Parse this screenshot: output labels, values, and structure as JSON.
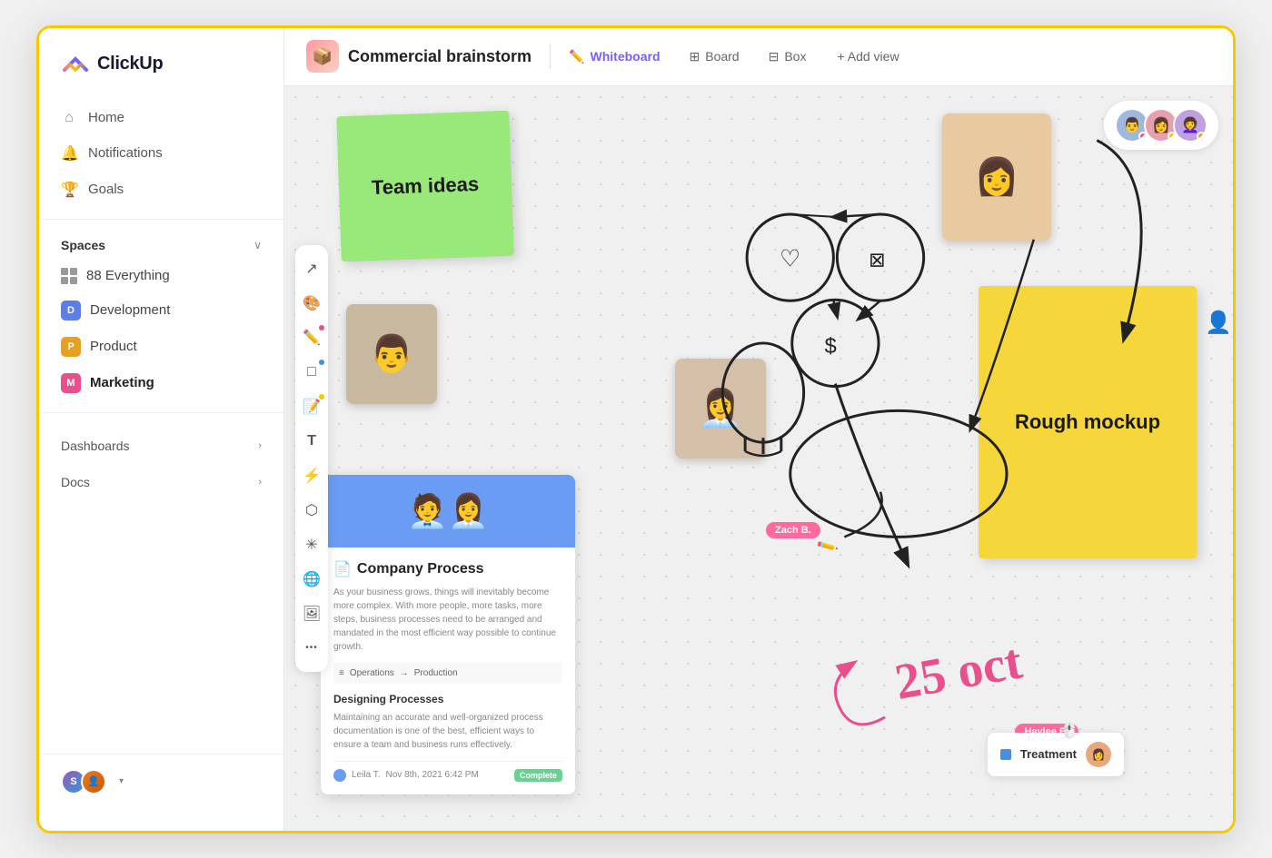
{
  "app": {
    "name": "ClickUp"
  },
  "sidebar": {
    "nav": [
      {
        "id": "home",
        "label": "Home",
        "icon": "⌂"
      },
      {
        "id": "notifications",
        "label": "Notifications",
        "icon": "🔔"
      },
      {
        "id": "goals",
        "label": "Goals",
        "icon": "🏆"
      }
    ],
    "spaces_label": "Spaces",
    "spaces": [
      {
        "id": "everything",
        "label": "Everything",
        "count": "88"
      },
      {
        "id": "development",
        "label": "Development",
        "badge": "D",
        "color": "#5b7fe8"
      },
      {
        "id": "product",
        "label": "Product",
        "badge": "P",
        "color": "#e8a020"
      },
      {
        "id": "marketing",
        "label": "Marketing",
        "badge": "M",
        "color": "#e84f8c",
        "bold": true
      }
    ],
    "sections": [
      {
        "id": "dashboards",
        "label": "Dashboards"
      },
      {
        "id": "docs",
        "label": "Docs"
      }
    ]
  },
  "header": {
    "page_icon": "📦",
    "page_title": "Commercial brainstorm",
    "tabs": [
      {
        "id": "whiteboard",
        "label": "Whiteboard",
        "icon": "✏️",
        "active": true
      },
      {
        "id": "board",
        "label": "Board",
        "icon": "⊞"
      },
      {
        "id": "box",
        "label": "Box",
        "icon": "⊟"
      }
    ],
    "add_view_label": "+ Add view"
  },
  "toolbar": {
    "tools": [
      {
        "id": "cursor",
        "icon": "↗",
        "dot": null
      },
      {
        "id": "palette",
        "icon": "🎨",
        "dot": null
      },
      {
        "id": "pen",
        "icon": "✏️",
        "dot": "#e84f8c"
      },
      {
        "id": "rectangle",
        "icon": "□",
        "dot": "#4a90d9"
      },
      {
        "id": "sticky",
        "icon": "📝",
        "dot": "#f5c800"
      },
      {
        "id": "text",
        "icon": "T",
        "dot": null
      },
      {
        "id": "lightning",
        "icon": "⚡",
        "dot": null
      },
      {
        "id": "share",
        "icon": "⬡",
        "dot": null
      },
      {
        "id": "star",
        "icon": "✳",
        "dot": null
      },
      {
        "id": "globe",
        "icon": "🌐",
        "dot": null
      },
      {
        "id": "image",
        "icon": "🖼",
        "dot": null
      },
      {
        "id": "more",
        "icon": "•••",
        "dot": null
      }
    ]
  },
  "whiteboard": {
    "sticky_green": {
      "text": "Team ideas"
    },
    "sticky_yellow": {
      "text": "Rough mockup"
    },
    "labels": [
      {
        "id": "zach",
        "text": "Zach B."
      },
      {
        "id": "haylee",
        "text": "Haylee B."
      }
    ],
    "date_annotation": "25 oct",
    "doc_card": {
      "title": "Company Process",
      "description": "As your business grows, things will inevitably become more complex. With more people, more tasks, more steps, business processes need to be arranged and mandated in the most efficient way possible to continue growth.",
      "flow_from": "Operations",
      "flow_to": "Production",
      "section_title": "Designing Processes",
      "section_text": "Maintaining an accurate and well-organized process documentation is one of the best, efficient ways to ensure a team and business runs effectively.",
      "author": "Leila T.",
      "date": "Nov 8th, 2021 6:42 PM",
      "status": "Complete"
    },
    "treatment_card": {
      "label": "Treatment",
      "color": "#4a90d9"
    }
  },
  "collaborators": [
    {
      "id": "collab1",
      "color": "#a0b8e0",
      "dot_color": "#e84f8c"
    },
    {
      "id": "collab2",
      "color": "#e8a0b0",
      "dot_color": "#f5c800"
    },
    {
      "id": "collab3",
      "color": "#c0a0e0",
      "dot_color": "#e8a020"
    }
  ]
}
